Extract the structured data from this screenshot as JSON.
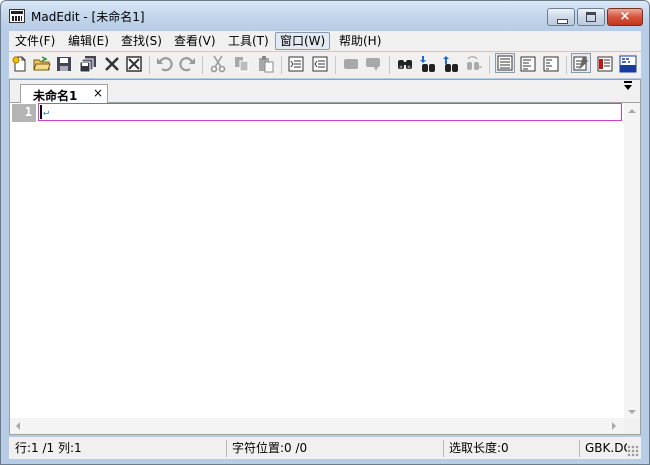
{
  "window": {
    "title": "MadEdit - [未命名1]",
    "close_glyph": "×"
  },
  "menu": [
    {
      "label": "文件(F)"
    },
    {
      "label": "编辑(E)"
    },
    {
      "label": "查找(S)"
    },
    {
      "label": "查看(V)"
    },
    {
      "label": "工具(T)"
    },
    {
      "label": "窗口(W)",
      "active": true
    },
    {
      "label": "帮助(H)"
    }
  ],
  "toolbar": [
    "new-file-icon",
    "open-file-icon",
    "save-icon",
    "save-all-icon",
    "close-file-icon",
    "close-all-icon",
    "undo-icon",
    "redo-icon",
    "cut-icon",
    "copy-icon",
    "paste-icon",
    "indent-icon",
    "unindent-icon",
    "comment-icon",
    "uncomment-icon",
    "find-icon",
    "find-next-icon",
    "find-previous-icon",
    "replace-icon",
    "text-mode-icon",
    "column-mode-icon",
    "hex-mode-icon",
    "word-wrap-icon",
    "text-mode-toggle-icon",
    "hex-view-icon"
  ],
  "tabs": [
    {
      "label": "未命名1",
      "close": "×"
    }
  ],
  "editor": {
    "line_numbers": [
      "1"
    ],
    "caret_mark": "↵"
  },
  "status": {
    "position": "行:1 /1 列:1",
    "char_pos": "字符位置:0 /0",
    "sel_len": "选取长度:0",
    "encoding": "GBK.DO"
  },
  "colors": {
    "current_line_border": "#d040d0",
    "gutter": "#b4b4b4",
    "caret_mark": "#2b7fd0",
    "close_button": "#c2361d"
  }
}
